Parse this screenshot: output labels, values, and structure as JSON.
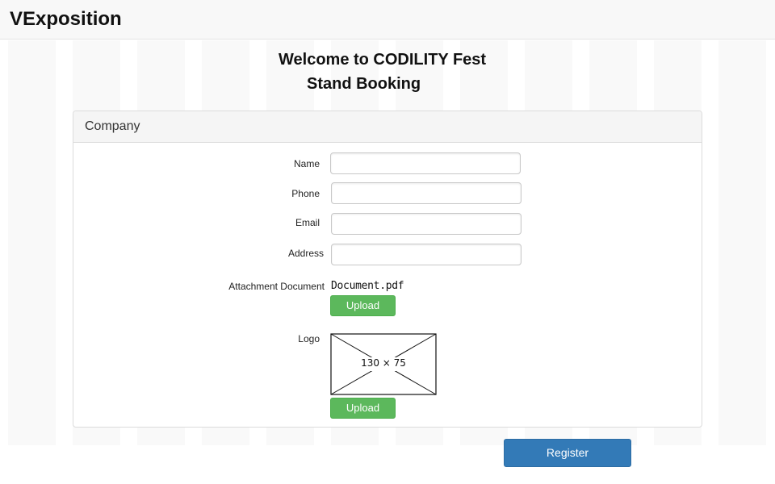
{
  "app": {
    "brand": "VExposition"
  },
  "page": {
    "title_line1": "Welcome to CODILITY Fest",
    "title_line2": "Stand Booking"
  },
  "panel": {
    "title": "Company"
  },
  "form": {
    "name_label": "Name",
    "name_value": "",
    "phone_label": "Phone",
    "phone_value": "",
    "email_label": "Email",
    "email_value": "",
    "address_label": "Address",
    "address_value": "",
    "attachment_label": "Attachment Document",
    "attachment_filename": "Document.pdf",
    "attachment_upload_label": "Upload",
    "logo_label": "Logo",
    "logo_placeholder_text": "130 × 75",
    "logo_upload_label": "Upload"
  },
  "actions": {
    "register_label": "Register"
  },
  "colors": {
    "upload_button": "#5cb85c",
    "register_button": "#337ab7",
    "header_bg": "#f8f8f8"
  },
  "icons": {
    "logo_placeholder": "image-placeholder-icon"
  }
}
